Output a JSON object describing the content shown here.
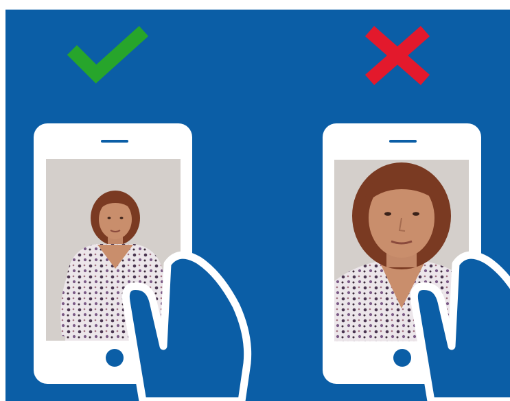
{
  "colors": {
    "background": "#0b5ea6",
    "frame": "#ffffff",
    "correct_mark": "#27a52b",
    "wrong_mark": "#e3192c",
    "photo_backdrop": "#d4cfcb",
    "hair": "#7a3a22",
    "skin": "#c98e6c",
    "blouse": "#ece6ea"
  },
  "panels": [
    {
      "verdict": "correct",
      "icon": "checkmark-icon",
      "framing": "half-body"
    },
    {
      "verdict": "wrong",
      "icon": "cross-icon",
      "framing": "close-up"
    }
  ]
}
